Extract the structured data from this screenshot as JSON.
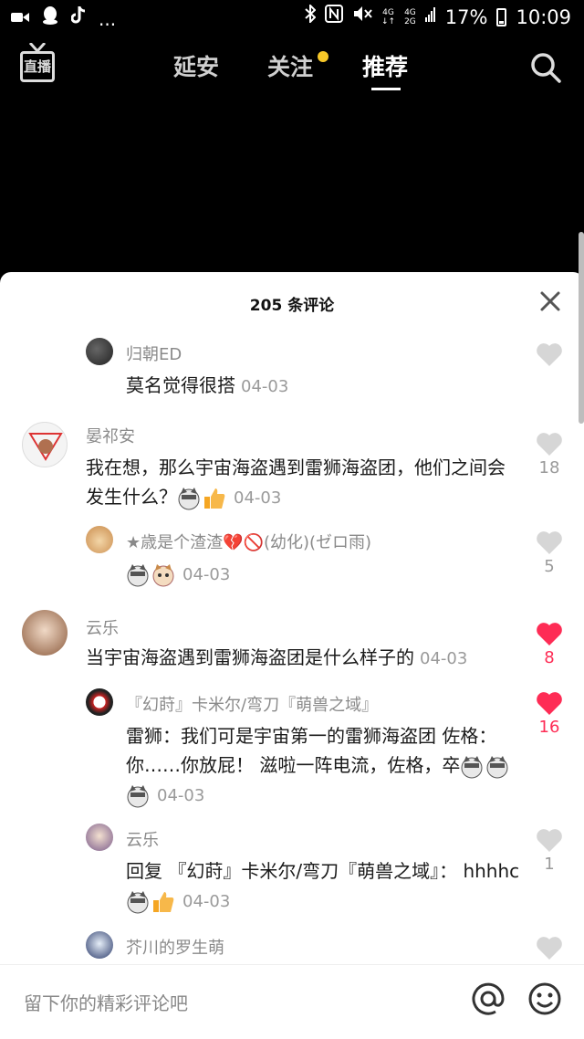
{
  "status_bar": {
    "battery": "17%",
    "time": "10:09",
    "ellipsis": "...",
    "net_top": "4G",
    "net_bottom": "2G"
  },
  "nav": {
    "live_label": "直播",
    "tabs": [
      "延安",
      "关注",
      "推荐"
    ],
    "active_tab": "推荐",
    "notification_dot_color": "#f6c728"
  },
  "comments": {
    "title": "205 条评论",
    "items": [
      {
        "user": "归朝ED",
        "text": "莫名觉得很搭",
        "date": "04-03",
        "likes": "",
        "liked": false,
        "reply": true
      },
      {
        "user": "晏祁安",
        "text": "我在想，那么宇宙海盗遇到雷狮海盗团，他们之间会发生什么？",
        "date": "04-03",
        "likes": "18",
        "liked": false,
        "reply": false,
        "emojis": [
          "dog-emoji",
          "thumbs-up-emoji"
        ]
      },
      {
        "user": "★歳是个渣渣💔🚫(幼化)(ゼロ雨)",
        "text": "",
        "date": "04-03",
        "likes": "5",
        "liked": false,
        "reply": true,
        "emojis": [
          "dog-emoji",
          "cat-emoji"
        ]
      },
      {
        "user": "云乐",
        "text": "当宇宙海盗遇到雷狮海盗团是什么样子的",
        "date": "04-03",
        "likes": "8",
        "liked": true,
        "reply": false
      },
      {
        "user": "『幻莳』卡米尔/弯刀『萌兽之域』",
        "text": "雷狮：我们可是宇宙第一的雷狮海盗团 佐格：你……你放屁！ 滋啦一阵电流，佐格，卒",
        "date": "04-03",
        "likes": "16",
        "liked": true,
        "reply": true,
        "emojis": [
          "dog-emoji",
          "dog-emoji",
          "dog-emoji"
        ]
      },
      {
        "user": "云乐",
        "text": "回复 『幻莳』卡米尔/弯刀『萌兽之域』： hhhhc",
        "date": "04-03",
        "likes": "1",
        "liked": false,
        "reply": true,
        "emojis": [
          "dog-emoji",
          "thumbs-up-emoji"
        ]
      },
      {
        "user": "芥川的罗生萌",
        "text": "",
        "date": "",
        "likes": "",
        "liked": false,
        "reply": true
      }
    ]
  },
  "input": {
    "placeholder": "留下你的精彩评论吧"
  },
  "colors": {
    "like_active": "#fe2c55",
    "like_inactive": "#d6d6d6"
  }
}
